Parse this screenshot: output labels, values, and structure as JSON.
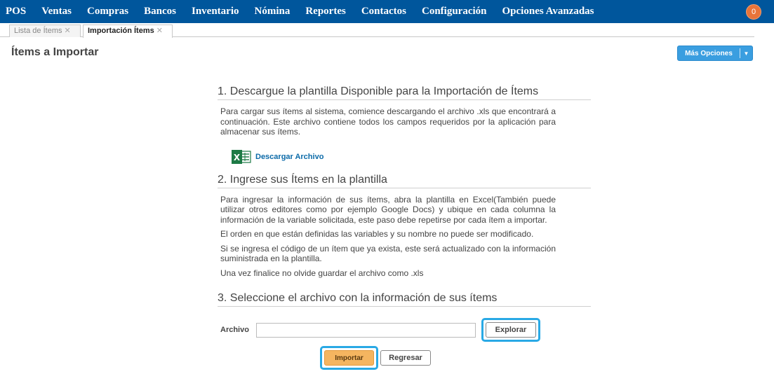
{
  "nav": {
    "items": [
      "POS",
      "Ventas",
      "Compras",
      "Bancos",
      "Inventario",
      "Nómina",
      "Reportes",
      "Contactos",
      "Configuración",
      "Opciones Avanzadas"
    ],
    "notification_count": "0"
  },
  "tabs": [
    {
      "label": "Lista de Ítems",
      "active": false
    },
    {
      "label": "Importación Ítems",
      "active": true
    }
  ],
  "page": {
    "title": "Ítems a Importar",
    "more_options_label": "Más Opciones"
  },
  "step1": {
    "title": "1. Descargue la plantilla Disponible para la Importación de Ítems",
    "text": "Para cargar sus ítems al sistema, comience descargando el archivo .xls que encontrará a continuación. Este archivo contiene todos los campos requeridos por la aplicación para almacenar sus ítems.",
    "download_label": "Descargar Archivo"
  },
  "step2": {
    "title": "2. Ingrese sus Ítems en la plantilla",
    "paragraphs": [
      "Para ingresar la información de sus ítems, abra la plantilla en Excel(También puede utilizar otros editores como por ejemplo Google Docs) y ubique en cada columna la información de la variable solicitada, este paso debe repetirse por cada ítem a importar.",
      "El orden en que están definidas las variables y su nombre no puede ser modificado.",
      "Si se ingresa el código de un ítem que ya exista, este será actualizado con la información suministrada en la plantilla.",
      "Una vez finalice no olvide guardar el archivo como .xls"
    ]
  },
  "step3": {
    "title": "3. Seleccione el archivo con la información de sus ítems",
    "file_label": "Archivo",
    "file_value": "",
    "browse_label": "Explorar"
  },
  "actions": {
    "import_label": "Importar",
    "back_label": "Regresar"
  },
  "colors": {
    "nav_bg": "#00569c",
    "accent_blue": "#3a9ee0",
    "highlight": "#29a9e5",
    "import_orange": "#f5b560",
    "badge": "#e8743a"
  }
}
